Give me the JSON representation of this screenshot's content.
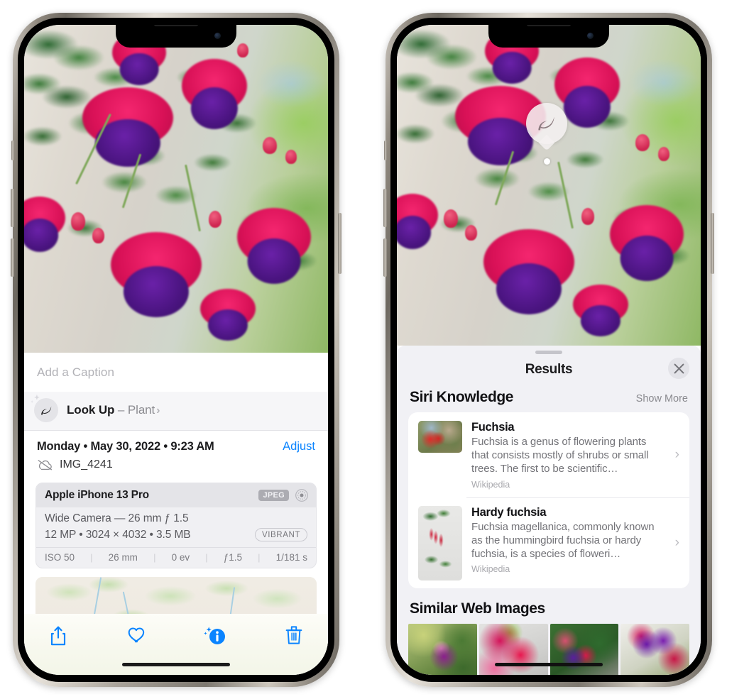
{
  "left_phone": {
    "photo": {
      "alt_name": "fuchsia-flowers-photo"
    },
    "caption_placeholder": "Add a Caption",
    "lookup": {
      "icon": "leaf-icon",
      "sparkle_icon": "sparkles-icon",
      "label": "Look Up",
      "dash": " – ",
      "subject": "Plant",
      "chevron": "›"
    },
    "meta": {
      "date_line": "Monday • May 30, 2022 • 9:23 AM",
      "adjust_label": "Adjust",
      "cloud_icon": "icloud-slash-icon",
      "filename": "IMG_4241"
    },
    "exif": {
      "device": "Apple iPhone 13 Pro",
      "format_badge": "JPEG",
      "lens_icon": "camera-lens-icon",
      "lens_line": "Wide Camera — 26 mm ƒ 1.5",
      "specs_line": "12 MP • 3024 × 4032 • 3.5 MB",
      "style_badge": "VIBRANT",
      "settings": [
        "ISO 50",
        "26 mm",
        "0 ev",
        "ƒ1.5",
        "1/181 s"
      ]
    },
    "map": {
      "name": "location-map-thumbnail"
    },
    "tabbar": [
      {
        "name": "share-button",
        "icon": "share-icon"
      },
      {
        "name": "favorite-button",
        "icon": "heart-icon"
      },
      {
        "name": "info-button",
        "icon": "info-sparkle-icon"
      },
      {
        "name": "delete-button",
        "icon": "trash-icon"
      }
    ],
    "accent_color": "#0a84ff"
  },
  "right_phone": {
    "photo": {
      "alt_name": "fuchsia-flowers-photo"
    },
    "visual_lookup_badge": {
      "icon": "leaf-icon"
    },
    "sheet": {
      "title": "Results",
      "close_icon": "close-icon",
      "sections": [
        {
          "name": "siri-knowledge",
          "title": "Siri Knowledge",
          "action_label": "Show More",
          "items": [
            {
              "title": "Fuchsia",
              "description": "Fuchsia is a genus of flowering plants that consists mostly of shrubs or small trees. The first to be scientific…",
              "source": "Wikipedia",
              "chevron": "›"
            },
            {
              "title": "Hardy fuchsia",
              "description": "Fuchsia magellanica, commonly known as the hummingbird fuchsia or hardy fuchsia, is a species of floweri…",
              "source": "Wikipedia",
              "chevron": "›"
            }
          ]
        },
        {
          "name": "similar-web-images",
          "title": "Similar Web Images",
          "images": [
            {
              "name": "web-image-1"
            },
            {
              "name": "web-image-2"
            },
            {
              "name": "web-image-3"
            },
            {
              "name": "web-image-4"
            }
          ]
        }
      ]
    }
  }
}
